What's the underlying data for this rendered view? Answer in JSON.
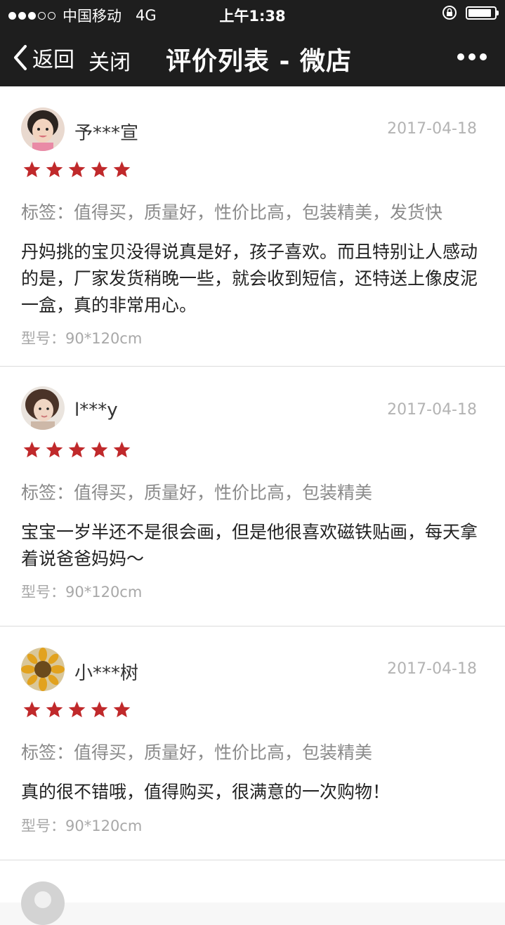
{
  "status_bar": {
    "carrier": "中国移动",
    "network": "4G",
    "time": "上午1:38",
    "signal_filled": 3,
    "signal_total": 5,
    "battery_level": 0.9,
    "icons": [
      "rotation-lock-icon",
      "battery-icon"
    ]
  },
  "nav": {
    "back_label": "返回",
    "close_label": "关闭",
    "title": "评价列表 - 微店",
    "icons": [
      "chevron-left-icon",
      "more-icon"
    ]
  },
  "colors": {
    "bar_bg": "#1e1e1e",
    "star": "#c0292b",
    "card_bg": "#ffffff",
    "page_bg": "#f7f7f7"
  },
  "reviews": [
    {
      "user": "予***宣",
      "date": "2017-04-18",
      "stars": 5,
      "tags": "标签：值得买，质量好，性价比高，包装精美，发货快",
      "content": "丹妈挑的宝贝没得说真是好，孩子喜欢。而且特别让人感动的是，厂家发货稍晚一些，就会收到短信，还特送上像皮泥一盒，真的非常用心。",
      "model": "型号：90*120cm"
    },
    {
      "user": "l***y",
      "date": "2017-04-18",
      "stars": 5,
      "tags": "标签：值得买，质量好，性价比高，包装精美",
      "content": "宝宝一岁半还不是很会画，但是他很喜欢磁铁贴画，每天拿着说爸爸妈妈～",
      "model": "型号：90*120cm"
    },
    {
      "user": "小***树",
      "date": "2017-04-18",
      "stars": 5,
      "tags": "标签：值得买，质量好，性价比高，包装精美",
      "content": "真的很不错哦，值得购买，很满意的一次购物！",
      "model": "型号：90*120cm"
    }
  ]
}
